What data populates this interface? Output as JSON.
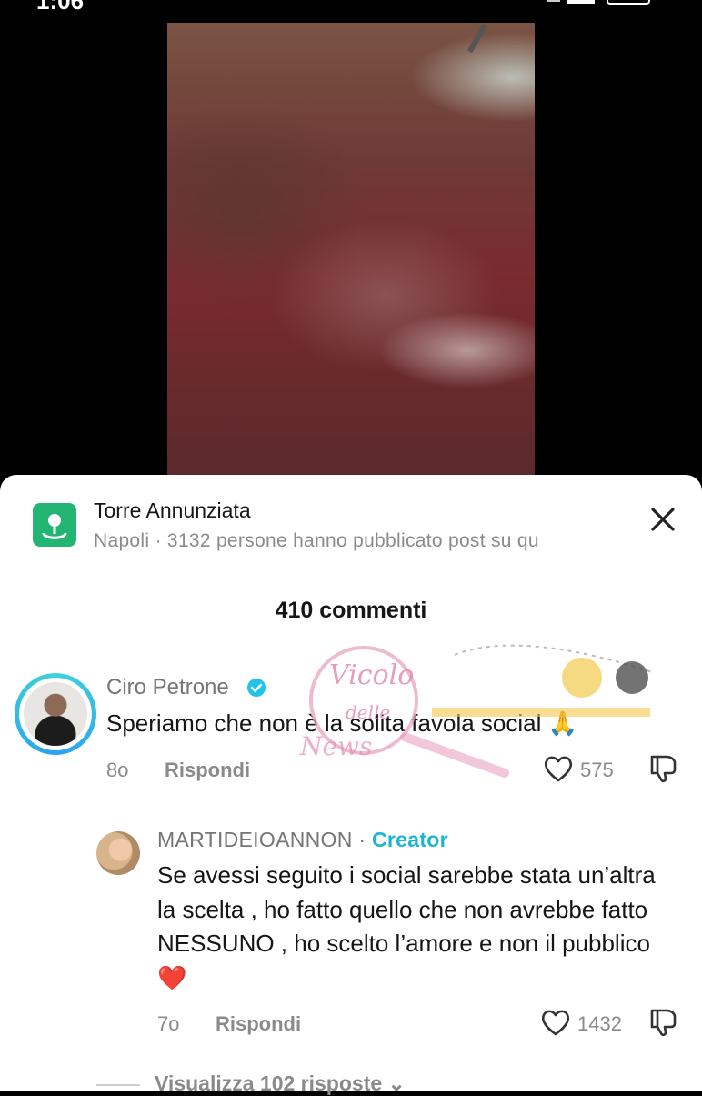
{
  "status_bar": {
    "time": "1:06"
  },
  "location": {
    "title": "Torre Annunziata",
    "subtitle": "Napoli · 3132 persone hanno pubblicato post su qu"
  },
  "comments_count": "410 commenti",
  "comments": [
    {
      "author": "Ciro Petrone",
      "text": "Speriamo che non è la solita favola social 🙏",
      "time": "8o",
      "reply_label": "Rispondi",
      "likes": "575"
    }
  ],
  "reply": {
    "author": "MARTIDEIOANNON",
    "separator": " · ",
    "badge": "Creator",
    "text": "Se avessi seguito i social sarebbe stata un’altra la scelta , ho fatto quello che non avrebbe fatto NESSUNO , ho scelto l’amore e non il pubblico❤️",
    "time": "7o",
    "reply_label": "Rispondi",
    "likes": "1432"
  },
  "view_replies": "Visualizza 102 risposte",
  "watermark_text": "Vicolo delle News",
  "colors": {
    "accent": "#19b6d4",
    "location_icon": "#22b573",
    "verified": "#20c4e6"
  }
}
